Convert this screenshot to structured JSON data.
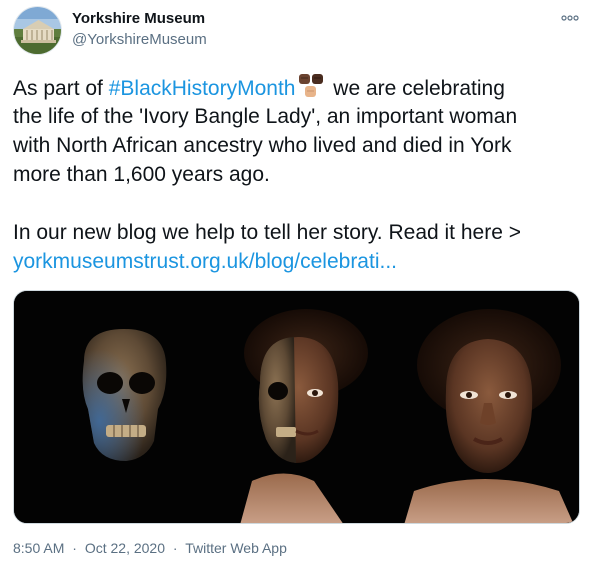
{
  "author": {
    "display_name": "Yorkshire Museum",
    "handle": "@YorkshireMuseum"
  },
  "tweet": {
    "line1_prefix": "As part of ",
    "hashtag": "#BlackHistoryMonth",
    "line1_suffix": " we are celebrating",
    "line2": "the life of the 'Ivory Bangle Lady', an important woman",
    "line3": "with North African ancestry who lived and died in York",
    "line4": "more than 1,600 years ago.",
    "line5": "In our new blog we help to tell her story. Read it here >",
    "link": "yorkmuseumstrust.org.uk/blog/celebrati..."
  },
  "meta": {
    "time": "8:50 AM",
    "dot": "·",
    "date": "Oct 22, 2020",
    "source": "Twitter Web App"
  },
  "icons": {
    "more": "more-horizontal-icon",
    "emoji": "raised-fists-emoji"
  },
  "colors": {
    "link": "#1b95e0",
    "secondary_text": "#5b7083",
    "text": "#0f1419"
  }
}
